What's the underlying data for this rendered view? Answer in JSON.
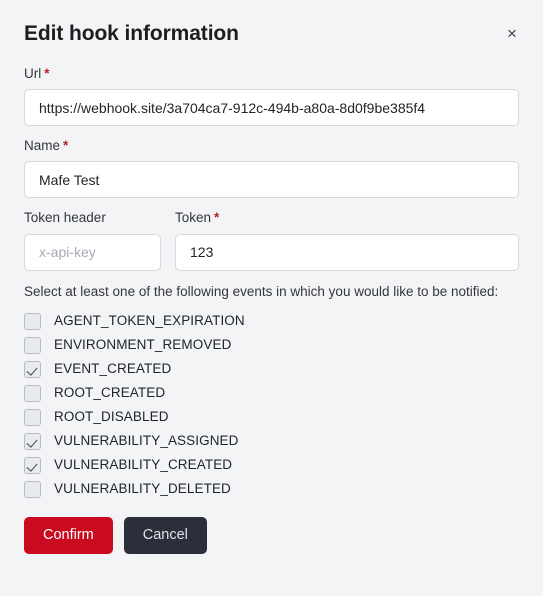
{
  "dialog": {
    "title": "Edit hook information",
    "close_label": "×"
  },
  "fields": {
    "url": {
      "label": "Url",
      "required_mark": "*",
      "value": "https://webhook.site/3a704ca7-912c-494b-a80a-8d0f9be385f4",
      "placeholder": ""
    },
    "name": {
      "label": "Name",
      "required_mark": "*",
      "value": "Mafe Test",
      "placeholder": ""
    },
    "token_header": {
      "label": "Token header",
      "required_mark": "",
      "value": "",
      "placeholder": "x-api-key"
    },
    "token": {
      "label": "Token",
      "required_mark": "*",
      "value": "123",
      "placeholder": ""
    }
  },
  "events": {
    "intro": "Select at least one of the following events in which you would like to be notified:",
    "items": [
      {
        "label": "AGENT_TOKEN_EXPIRATION",
        "checked": false
      },
      {
        "label": "ENVIRONMENT_REMOVED",
        "checked": false
      },
      {
        "label": "EVENT_CREATED",
        "checked": true
      },
      {
        "label": "ROOT_CREATED",
        "checked": false
      },
      {
        "label": "ROOT_DISABLED",
        "checked": false
      },
      {
        "label": "VULNERABILITY_ASSIGNED",
        "checked": true
      },
      {
        "label": "VULNERABILITY_CREATED",
        "checked": true
      },
      {
        "label": "VULNERABILITY_DELETED",
        "checked": false
      }
    ]
  },
  "footer": {
    "confirm_label": "Confirm",
    "cancel_label": "Cancel"
  },
  "colors": {
    "background": "#f3f4f6",
    "confirm": "#c90a1f",
    "cancel": "#2b2f3a",
    "required": "#b3242f"
  }
}
